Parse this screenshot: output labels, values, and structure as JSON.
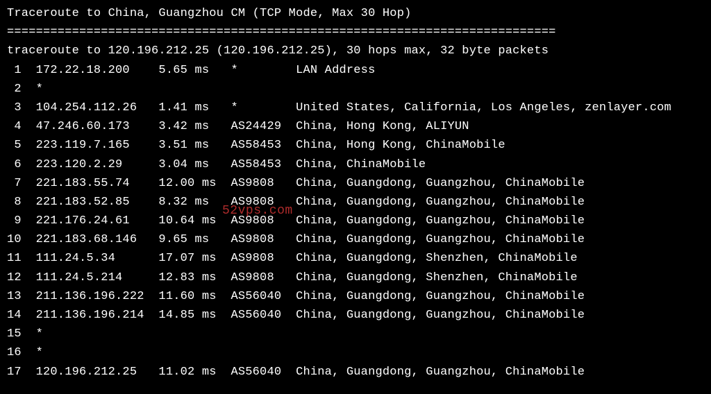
{
  "title": "Traceroute to China, Guangzhou CM (TCP Mode, Max 30 Hop)",
  "divider": "============================================================================",
  "command": "traceroute to 120.196.212.25 (120.196.212.25), 30 hops max, 32 byte packets",
  "watermark": "52vps.com",
  "hops": [
    {
      "num": " 1",
      "ip": "172.22.18.200",
      "time": "5.65 ms",
      "asn": "*",
      "loc": "LAN Address"
    },
    {
      "num": " 2",
      "ip": "*",
      "time": "",
      "asn": "",
      "loc": ""
    },
    {
      "num": " 3",
      "ip": "104.254.112.26",
      "time": "1.41 ms",
      "asn": "*",
      "loc": "United States, California, Los Angeles, zenlayer.com"
    },
    {
      "num": " 4",
      "ip": "47.246.60.173",
      "time": "3.42 ms",
      "asn": "AS24429",
      "loc": "China, Hong Kong, ALIYUN"
    },
    {
      "num": " 5",
      "ip": "223.119.7.165",
      "time": "3.51 ms",
      "asn": "AS58453",
      "loc": "China, Hong Kong, ChinaMobile"
    },
    {
      "num": " 6",
      "ip": "223.120.2.29",
      "time": "3.04 ms",
      "asn": "AS58453",
      "loc": "China, ChinaMobile"
    },
    {
      "num": " 7",
      "ip": "221.183.55.74",
      "time": "12.00 ms",
      "asn": "AS9808",
      "loc": "China, Guangdong, Guangzhou, ChinaMobile"
    },
    {
      "num": " 8",
      "ip": "221.183.52.85",
      "time": "8.32 ms",
      "asn": "AS9808",
      "loc": "China, Guangdong, Guangzhou, ChinaMobile"
    },
    {
      "num": " 9",
      "ip": "221.176.24.61",
      "time": "10.64 ms",
      "asn": "AS9808",
      "loc": "China, Guangdong, Guangzhou, ChinaMobile"
    },
    {
      "num": "10",
      "ip": "221.183.68.146",
      "time": "9.65 ms",
      "asn": "AS9808",
      "loc": "China, Guangdong, Guangzhou, ChinaMobile"
    },
    {
      "num": "11",
      "ip": "111.24.5.34",
      "time": "17.07 ms",
      "asn": "AS9808",
      "loc": "China, Guangdong, Shenzhen, ChinaMobile"
    },
    {
      "num": "12",
      "ip": "111.24.5.214",
      "time": "12.83 ms",
      "asn": "AS9808",
      "loc": "China, Guangdong, Shenzhen, ChinaMobile"
    },
    {
      "num": "13",
      "ip": "211.136.196.222",
      "time": "11.60 ms",
      "asn": "AS56040",
      "loc": "China, Guangdong, Guangzhou, ChinaMobile"
    },
    {
      "num": "14",
      "ip": "211.136.196.214",
      "time": "14.85 ms",
      "asn": "AS56040",
      "loc": "China, Guangdong, Guangzhou, ChinaMobile"
    },
    {
      "num": "15",
      "ip": "*",
      "time": "",
      "asn": "",
      "loc": ""
    },
    {
      "num": "16",
      "ip": "*",
      "time": "",
      "asn": "",
      "loc": ""
    },
    {
      "num": "17",
      "ip": "120.196.212.25",
      "time": "11.02 ms",
      "asn": "AS56040",
      "loc": "China, Guangdong, Guangzhou, ChinaMobile"
    }
  ]
}
